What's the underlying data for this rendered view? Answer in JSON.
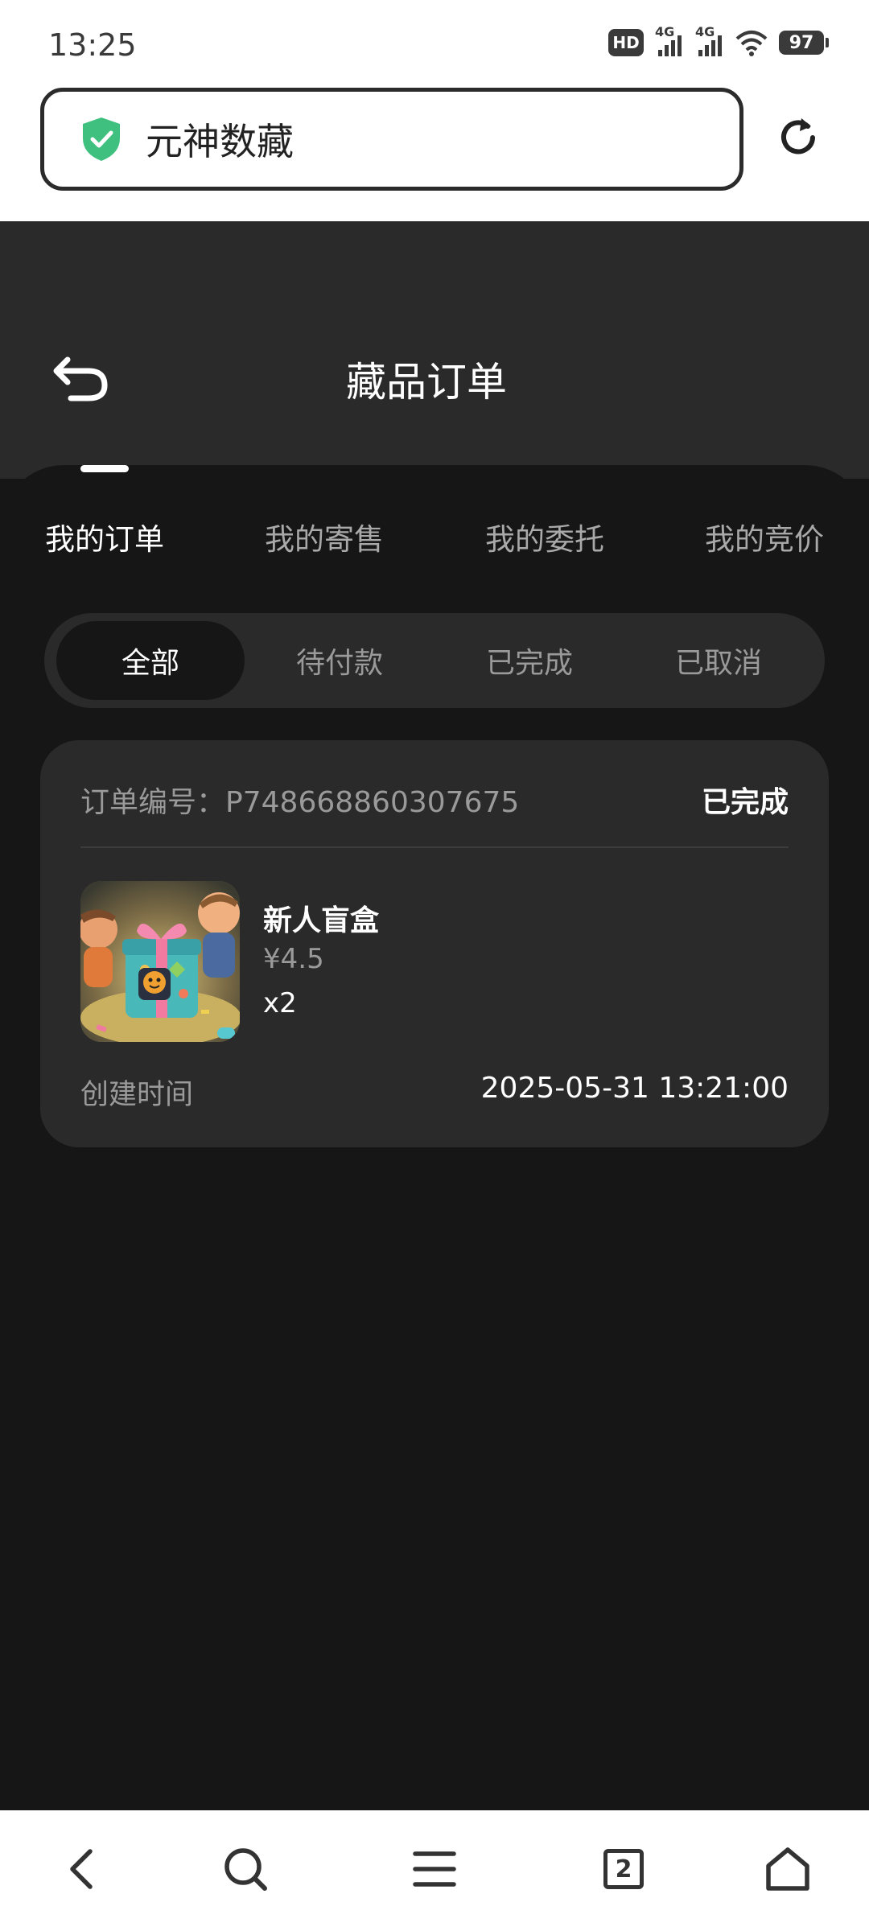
{
  "status_bar": {
    "time": "13:25",
    "hd_label": "HD",
    "network_1": "4G",
    "network_2": "4G",
    "battery": "97"
  },
  "browser": {
    "url_title": "元神数藏",
    "secure_icon": "shield-check-icon",
    "reload_icon": "reload-icon"
  },
  "header": {
    "title": "藏品订单",
    "back_icon": "return-arrow-icon"
  },
  "tabs": [
    {
      "label": "我的订单",
      "active": true
    },
    {
      "label": "我的寄售",
      "active": false
    },
    {
      "label": "我的委托",
      "active": false
    },
    {
      "label": "我的竞价",
      "active": false
    }
  ],
  "filters": [
    {
      "label": "全部",
      "active": true
    },
    {
      "label": "待付款",
      "active": false
    },
    {
      "label": "已完成",
      "active": false
    },
    {
      "label": "已取消",
      "active": false
    }
  ],
  "order": {
    "order_no_label": "订单编号：",
    "order_no": "P748668860307675",
    "status": "已完成",
    "item_name": "新人盲盒",
    "price": "¥4.5",
    "quantity": "x2",
    "created_label": "创建时间",
    "created_value": "2025-05-31 13:21:00"
  },
  "bottom_nav": {
    "tab_count": "2",
    "icons": [
      "back-icon",
      "search-icon",
      "menu-icon",
      "tabs-icon",
      "home-icon"
    ]
  },
  "colors": {
    "background": "#161616",
    "card": "#2a2a2a",
    "header": "#2a2a2a",
    "secure": "#3fc07f"
  }
}
